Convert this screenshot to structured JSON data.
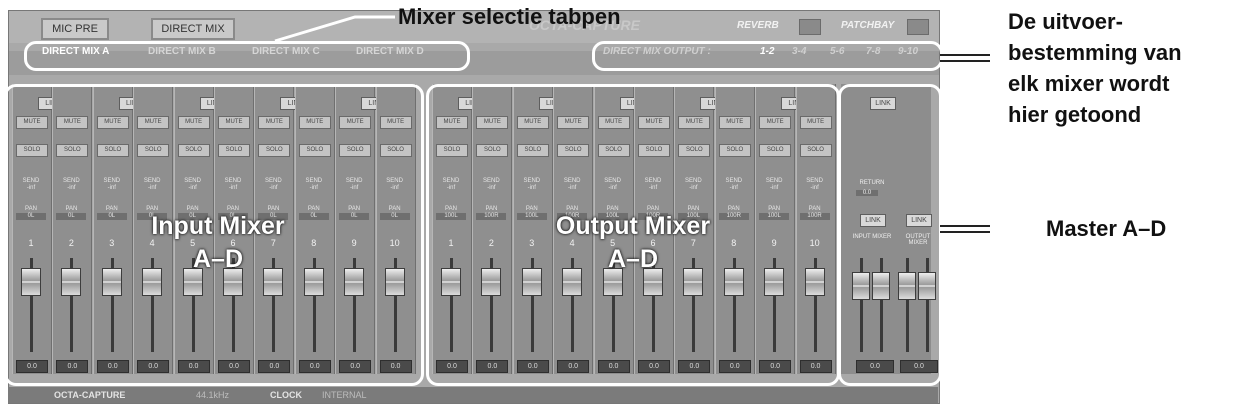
{
  "top_buttons": {
    "mic_pre": "MIC PRE",
    "direct_mix": "DIRECT MIX"
  },
  "window_title": "OCTA-CAPTURE",
  "right_tabs": {
    "reverb": "REVERB",
    "patchbay": "PATCHBAY"
  },
  "mix_tabs": [
    "DIRECT MIX A",
    "DIRECT MIX B",
    "DIRECT MIX C",
    "DIRECT MIX D"
  ],
  "output": {
    "label": "DIRECT MIX OUTPUT :",
    "options": [
      "1-2",
      "3-4",
      "5-6",
      "7-8",
      "9-10"
    ],
    "selected": "1-2"
  },
  "strip_labels": {
    "link": "LINK",
    "mute": "MUTE",
    "solo": "SOLO",
    "send": "SEND",
    "send_value": "-inf",
    "pan": "PAN"
  },
  "input_channels": [
    {
      "num": "1",
      "pan": "0L",
      "level": "0.0"
    },
    {
      "num": "2",
      "pan": "0L",
      "level": "0.0"
    },
    {
      "num": "3",
      "pan": "0L",
      "level": "0.0"
    },
    {
      "num": "4",
      "pan": "0L",
      "level": "0.0"
    },
    {
      "num": "5",
      "pan": "0L",
      "level": "0.0"
    },
    {
      "num": "6",
      "pan": "0L",
      "level": "0.0"
    },
    {
      "num": "7",
      "pan": "0L",
      "level": "0.0"
    },
    {
      "num": "8",
      "pan": "0L",
      "level": "0.0"
    },
    {
      "num": "9",
      "pan": "0L",
      "level": "0.0"
    },
    {
      "num": "10",
      "pan": "0L",
      "level": "0.0"
    }
  ],
  "output_channels": [
    {
      "num": "1",
      "pan": "100L",
      "level": "0.0"
    },
    {
      "num": "2",
      "pan": "100R",
      "level": "0.0"
    },
    {
      "num": "3",
      "pan": "100L",
      "level": "0.0"
    },
    {
      "num": "4",
      "pan": "100R",
      "level": "0.0"
    },
    {
      "num": "5",
      "pan": "100L",
      "level": "0.0"
    },
    {
      "num": "6",
      "pan": "100R",
      "level": "0.0"
    },
    {
      "num": "7",
      "pan": "100L",
      "level": "0.0"
    },
    {
      "num": "8",
      "pan": "100R",
      "level": "0.0"
    },
    {
      "num": "9",
      "pan": "100L",
      "level": "0.0"
    },
    {
      "num": "10",
      "pan": "100R",
      "level": "0.0"
    }
  ],
  "master": {
    "link": "LINK",
    "return_label": "RETURN",
    "return_value": "0.0",
    "input_label": "INPUT MIXER",
    "output_label": "OUTPUT MIXER",
    "input_level": "0.0",
    "output_level": "0.0"
  },
  "status_bar": {
    "device": "OCTA-CAPTURE",
    "rate": "44.1kHz",
    "clock_label": "CLOCK",
    "clock_value": "INTERNAL"
  },
  "annotations": {
    "tabs_callout": "Mixer selectie tabpen",
    "output_callout": [
      "De uitvoer-",
      "bestemming van",
      "elk mixer wordt",
      "hier getoond"
    ],
    "master_callout": "Master A–D",
    "input_overlay": [
      "Input Mixer",
      "A–D"
    ],
    "output_overlay": [
      "Output Mixer",
      "A–D"
    ]
  },
  "colors": {
    "panel": "#a9a9a9",
    "strip": "#8f8f8f",
    "callout": "#ffffff",
    "text_dark": "#111111"
  }
}
